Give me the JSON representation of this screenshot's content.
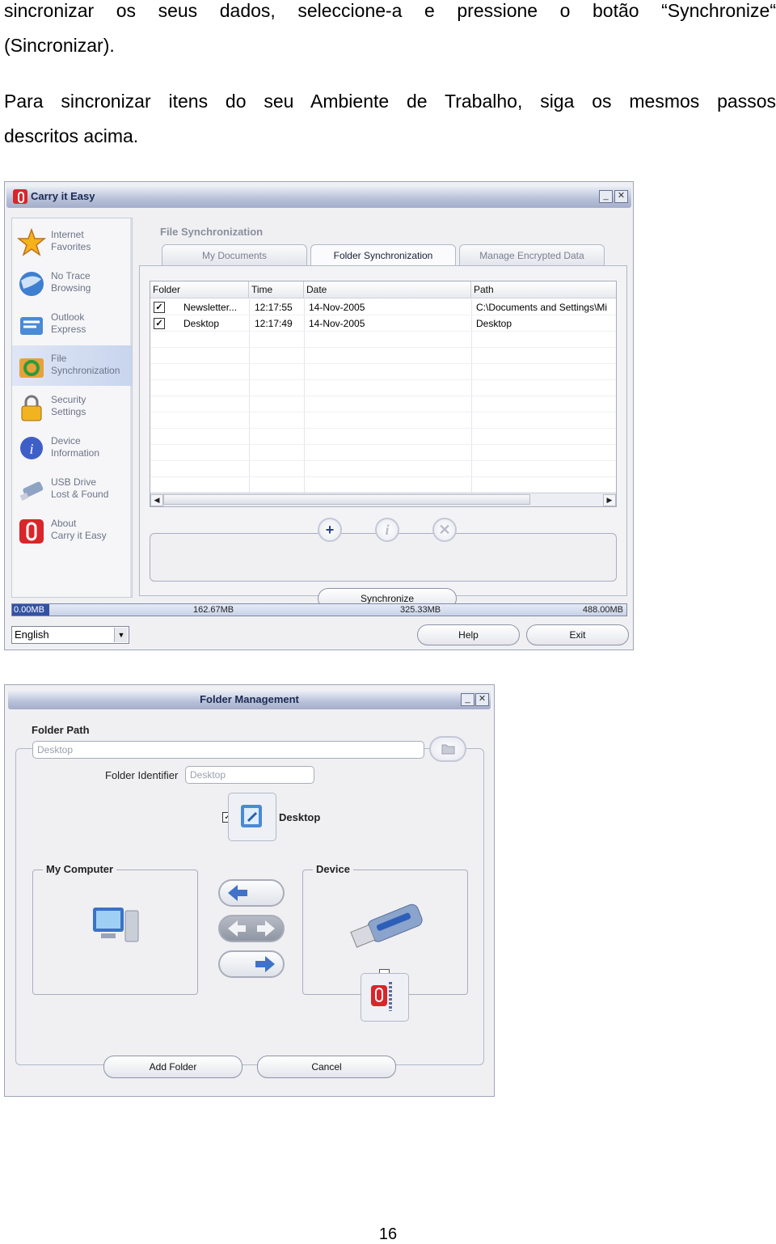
{
  "text": {
    "p1_line1": "sincronizar os seus dados, seleccione-a e pressione o botão “Synchronize“",
    "p1_line2": "(Sincronizar).",
    "p2_line1": "Para sincronizar itens do seu Ambiente de Trabalho, siga os mesmos passos",
    "p2_line2": "descritos acima."
  },
  "main_window": {
    "title": "Carry it Easy",
    "sidebar": [
      {
        "line1": "Internet",
        "line2": "Favorites"
      },
      {
        "line1": "No Trace",
        "line2": "Browsing"
      },
      {
        "line1": "Outlook",
        "line2": "Express"
      },
      {
        "line1": "File",
        "line2": "Synchronization"
      },
      {
        "line1": "Security",
        "line2": "Settings"
      },
      {
        "line1": "Device",
        "line2": "Information"
      },
      {
        "line1": "USB Drive",
        "line2": "Lost & Found"
      },
      {
        "line1": "About",
        "line2": "Carry it Easy"
      }
    ],
    "section_title": "File Synchronization",
    "tabs": [
      "My Documents",
      "Folder Synchronization",
      "Manage Encrypted Data"
    ],
    "active_tab": "Folder Synchronization",
    "columns": [
      "Folder",
      "Time",
      "Date",
      "Path"
    ],
    "rows": [
      {
        "checked": true,
        "folder": "Newsletter...",
        "time": "12:17:55",
        "date": "14-Nov-2005",
        "path": "C:\\Documents and Settings\\Mi"
      },
      {
        "checked": true,
        "folder": "Desktop",
        "time": "12:17:49",
        "date": "14-Nov-2005",
        "path": "Desktop"
      }
    ],
    "action_icons": [
      "plus-icon",
      "info-icon",
      "x-icon"
    ],
    "synchronize_label": "Synchronize",
    "status": {
      "s0": "0.00MB",
      "s1": "162.67MB",
      "s2": "325.33MB",
      "s3": "488.00MB",
      "used_fraction": 0.06
    },
    "language": "English",
    "help_label": "Help",
    "exit_label": "Exit",
    "colors": {
      "accent": "#3452a4",
      "logo_red": "#d8262a"
    }
  },
  "folder_window": {
    "title": "Folder Management",
    "folder_path_label": "Folder Path",
    "folder_path_value": "Desktop",
    "identifier_label": "Folder Identifier",
    "identifier_value": "Desktop",
    "item_name": "Desktop",
    "my_computer_label": "My Computer",
    "device_label": "Device",
    "add_folder_label": "Add Folder",
    "cancel_label": "Cancel"
  },
  "page_number": "16"
}
